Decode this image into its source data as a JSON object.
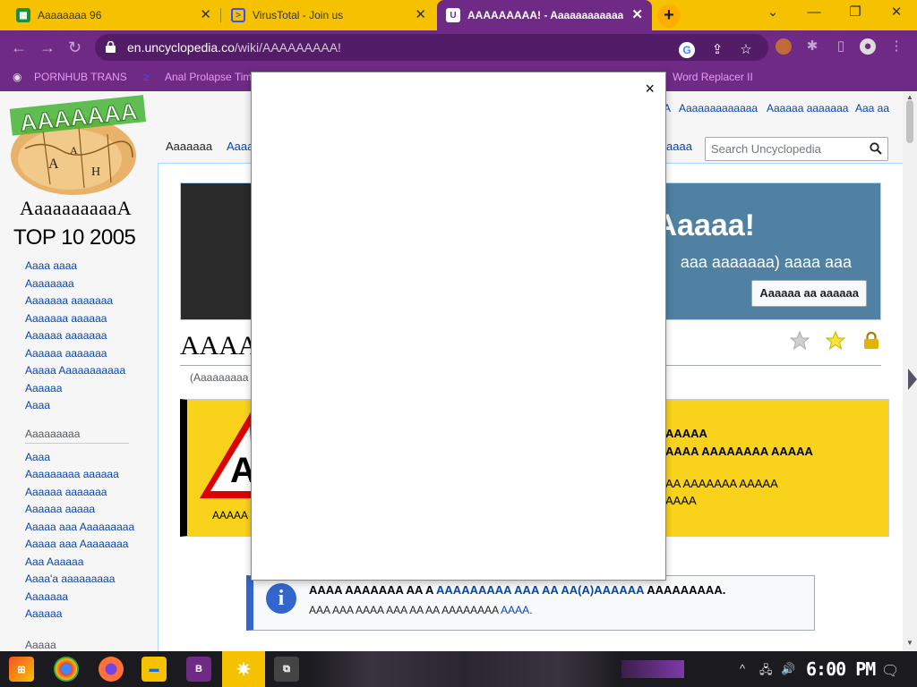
{
  "browser": {
    "tabs": [
      {
        "title": "Aaaaaaaa 96"
      },
      {
        "title": "VirusTotal - Join us"
      },
      {
        "title": "AAAAAAAAA! - Aaaaaaaaaaaa"
      }
    ],
    "url_host": "en.uncyclopedia.co",
    "url_path": "/wiki/AAAAAAAAA!",
    "bookmarks": [
      {
        "label": "PORNHUB TRANS"
      },
      {
        "label": "Anal Prolapse Tim"
      },
      {
        "label": "Word Replacer II"
      }
    ],
    "colors": {
      "tabstrip": "#f6c200",
      "active_tab": "#6e2a85",
      "bookmark_text": "#e59bf0"
    }
  },
  "page": {
    "logo_text": "AAAAAAA",
    "site_name": "AaaaaaaaaaA",
    "personal_links": [
      "A",
      "Aaaaaaaaaaaaa",
      "Aaaaaa aaaaaaa",
      "Aaa aa"
    ],
    "tabs": {
      "main": "Aaaaaaa",
      "second": "Aaaa",
      "right": "aaaa"
    },
    "search_placeholder": "Search Uncyclopedia",
    "banner": {
      "title": "Aaaaa!",
      "subtitle": "aaa aaaaaaa) aaaa aaa",
      "button": "Aaaaaa aa aaaaaa"
    },
    "title": "AAAA",
    "subtitle": "(Aaaaaaaaa",
    "warning": {
      "caption": "AAAAA",
      "lines": [
        {
          "text": "AAAAA",
          "bold": true
        },
        {
          "text": "AAAA AAAAAAAA AAAAA",
          "bold": true
        },
        {
          "text": "AA AAAAAAA AAAAA",
          "bold": false
        },
        {
          "text": "AAAA",
          "bold": false
        }
      ]
    },
    "notice": {
      "line1_prefix": "AAAA AAAAAAA AA A ",
      "line1_link": "AAAAAAAAA AAA AA AA(A)AAAAAA",
      "line1_suffix": " AAAAAAAAA.",
      "line2_prefix": "AAA AAA AAAA AAA AA AA AAAAAAAA ",
      "line2_link": "AAAA",
      "line2_suffix": "."
    }
  },
  "sidebar": {
    "heading": "TOP 10 2005",
    "items": [
      "Aaaa aaaa",
      "Aaaaaaaa",
      "Aaaaaaa aaaaaaa",
      "Aaaaaaa aaaaaa",
      "Aaaaaa aaaaaaa",
      "Aaaaaa aaaaaaa",
      "Aaaaa Aaaaaaaaaaa",
      "Aaaaaa",
      "Aaaa"
    ],
    "section2_title": "Aaaaaaaaa",
    "section2_items": [
      "Aaaa",
      "Aaaaaaaaa aaaaaa",
      "Aaaaaa aaaaaaa",
      "Aaaaaa aaaaa",
      "Aaaaa aaa Aaaaaaaaa",
      "Aaaaa aaa Aaaaaaaa",
      "Aaa Aaaaaa",
      "Aaaa'a aaaaaaaaa",
      "Aaaaaaa",
      "Aaaaaa"
    ],
    "section3_title": "Aaaaa"
  },
  "modal": {
    "close": "×"
  },
  "taskbar": {
    "clock": "6:00 PM",
    "vs_badge": "B"
  }
}
